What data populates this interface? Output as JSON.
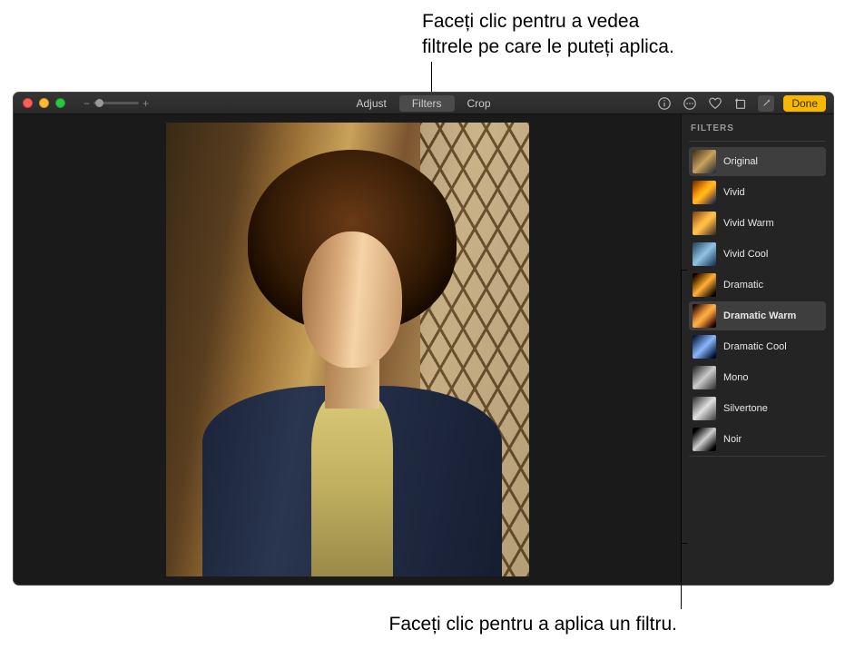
{
  "callouts": {
    "top": "Faceți clic pentru a vedea\nfiltrele pe care le puteți aplica.",
    "bottom": "Faceți clic pentru a aplica un filtru."
  },
  "toolbar": {
    "tabs": {
      "adjust": "Adjust",
      "filters": "Filters",
      "crop": "Crop"
    },
    "done": "Done"
  },
  "sidebar": {
    "title": "FILTERS",
    "filters": [
      {
        "label": "Original"
      },
      {
        "label": "Vivid"
      },
      {
        "label": "Vivid Warm"
      },
      {
        "label": "Vivid Cool"
      },
      {
        "label": "Dramatic"
      },
      {
        "label": "Dramatic Warm"
      },
      {
        "label": "Dramatic Cool"
      },
      {
        "label": "Mono"
      },
      {
        "label": "Silvertone"
      },
      {
        "label": "Noir"
      }
    ]
  }
}
